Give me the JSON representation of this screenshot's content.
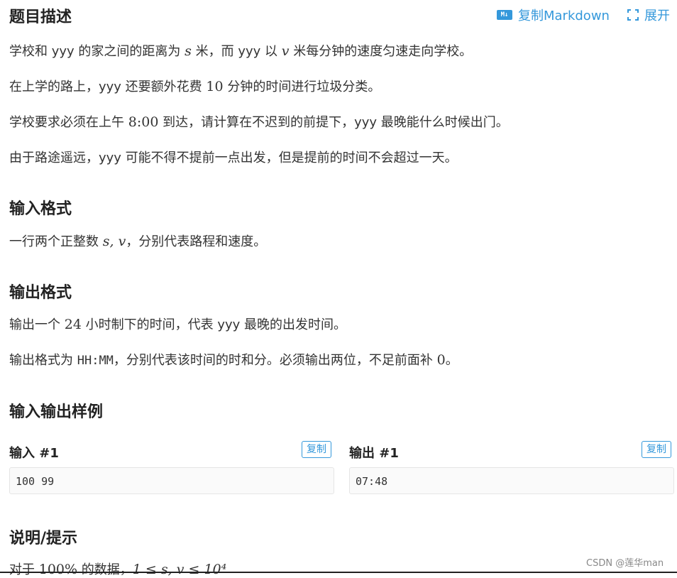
{
  "header": {
    "title": "题目描述",
    "copy_markdown": "复制Markdown",
    "expand": "展开",
    "md_badge": "M↓"
  },
  "description": {
    "p1": {
      "a": "学校和 yyy 的家之间的距离为 ",
      "var1": "s",
      "b": " 米，而 yyy 以 ",
      "var2": "v",
      "c": " 米每分钟的速度匀速走向学校。"
    },
    "p2": {
      "a": "在上学的路上，yyy 还要额外花费 ",
      "num": "10",
      "b": " 分钟的时间进行垃圾分类。"
    },
    "p3": {
      "a": "学校要求必须在上午 ",
      "time": "8:00",
      "b": " 到达，请计算在不迟到的前提下，yyy 最晚能什么时候出门。"
    },
    "p4": "由于路途遥远，yyy 可能不得不提前一点出发，但是提前的时间不会超过一天。"
  },
  "input_format": {
    "title": "输入格式",
    "text": {
      "a": "一行两个正整数 ",
      "math": "s, v",
      "b": "，分别代表路程和速度。"
    }
  },
  "output_format": {
    "title": "输出格式",
    "p1": {
      "a": "输出一个 ",
      "num": "24",
      "b": " 小时制下的时间，代表 yyy 最晚的出发时间。"
    },
    "p2": {
      "a": "输出格式为 ",
      "code": "HH:MM",
      "b": "，分别代表该时间的时和分。必须输出两位，不足前面补 ",
      "num": "0",
      "c": "。"
    }
  },
  "samples": {
    "title": "输入输出样例",
    "input_label": "输入 #1",
    "output_label": "输出 #1",
    "copy_label": "复制",
    "input_value": "100 99",
    "output_value": "07:48"
  },
  "hint": {
    "title": "说明/提示",
    "text": {
      "a": "对于 ",
      "pct": "100%",
      "b": " 的数据，",
      "math": "1 ≤ s, v ≤ 10⁴"
    }
  },
  "watermark": "CSDN @莲华man"
}
